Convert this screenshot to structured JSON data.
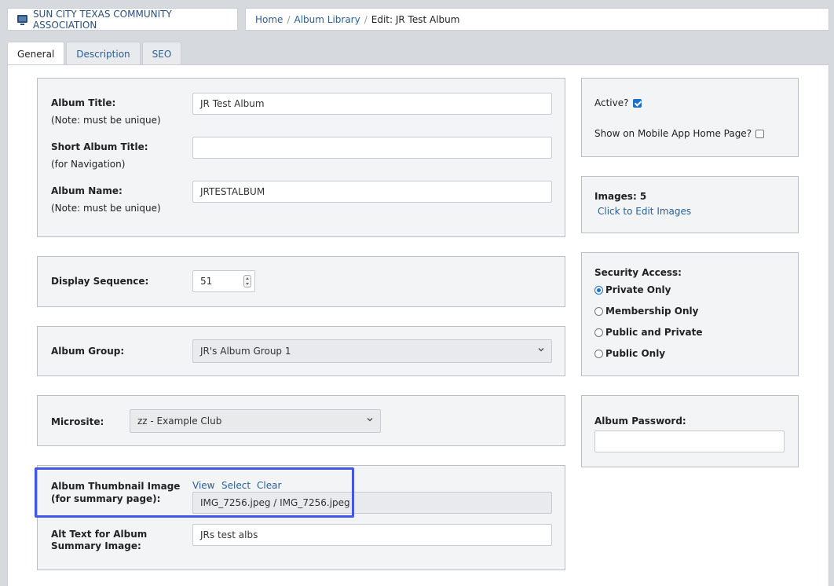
{
  "header": {
    "brand": "SUN CITY TEXAS COMMUNITY ASSOCIATION",
    "breadcrumb": {
      "home": "Home",
      "library": "Album Library",
      "current": "Edit: JR Test Album",
      "sep": "/"
    }
  },
  "tabs": [
    {
      "label": "General"
    },
    {
      "label": "Description"
    },
    {
      "label": "SEO"
    }
  ],
  "main": {
    "album_title": {
      "label": "Album Title:",
      "note": "(Note: must be unique)",
      "value": "JR Test Album"
    },
    "short_title": {
      "label": "Short Album Title:",
      "note": "(for Navigation)",
      "value": ""
    },
    "album_name": {
      "label": "Album Name:",
      "note": "(Note: must be unique)",
      "value": "JRTESTALBUM"
    },
    "display_sequence": {
      "label": "Display Sequence:",
      "value": "51"
    },
    "album_group": {
      "label": "Album Group:",
      "value": "JR's Album Group 1"
    },
    "microsite": {
      "label": "Microsite:",
      "value": "zz - Example Club"
    },
    "thumbnail": {
      "label": "Album Thumbnail Image (for summary page):",
      "view": "View",
      "select": "Select",
      "clear": "Clear",
      "value": "IMG_7256.jpeg / IMG_7256.jpeg"
    },
    "alt_text": {
      "label": "Alt Text for Album Summary Image:",
      "value": "JRs test albs"
    }
  },
  "side": {
    "active": {
      "label": "Active?",
      "checked": true
    },
    "mobile_home": {
      "label": "Show on Mobile App Home Page?",
      "checked": false
    },
    "images": {
      "label": "Images: 5",
      "link": "Click to Edit Images"
    },
    "security": {
      "label": "Security Access:",
      "options": [
        {
          "label": "Private Only",
          "selected": true
        },
        {
          "label": "Membership Only",
          "selected": false
        },
        {
          "label": "Public and Private",
          "selected": false
        },
        {
          "label": "Public Only",
          "selected": false
        }
      ]
    },
    "password": {
      "label": "Album Password:",
      "value": ""
    }
  },
  "colors": {
    "link": "#2a5f93",
    "highlight": "#4257e8",
    "checkbox": "#1a6fd1"
  }
}
